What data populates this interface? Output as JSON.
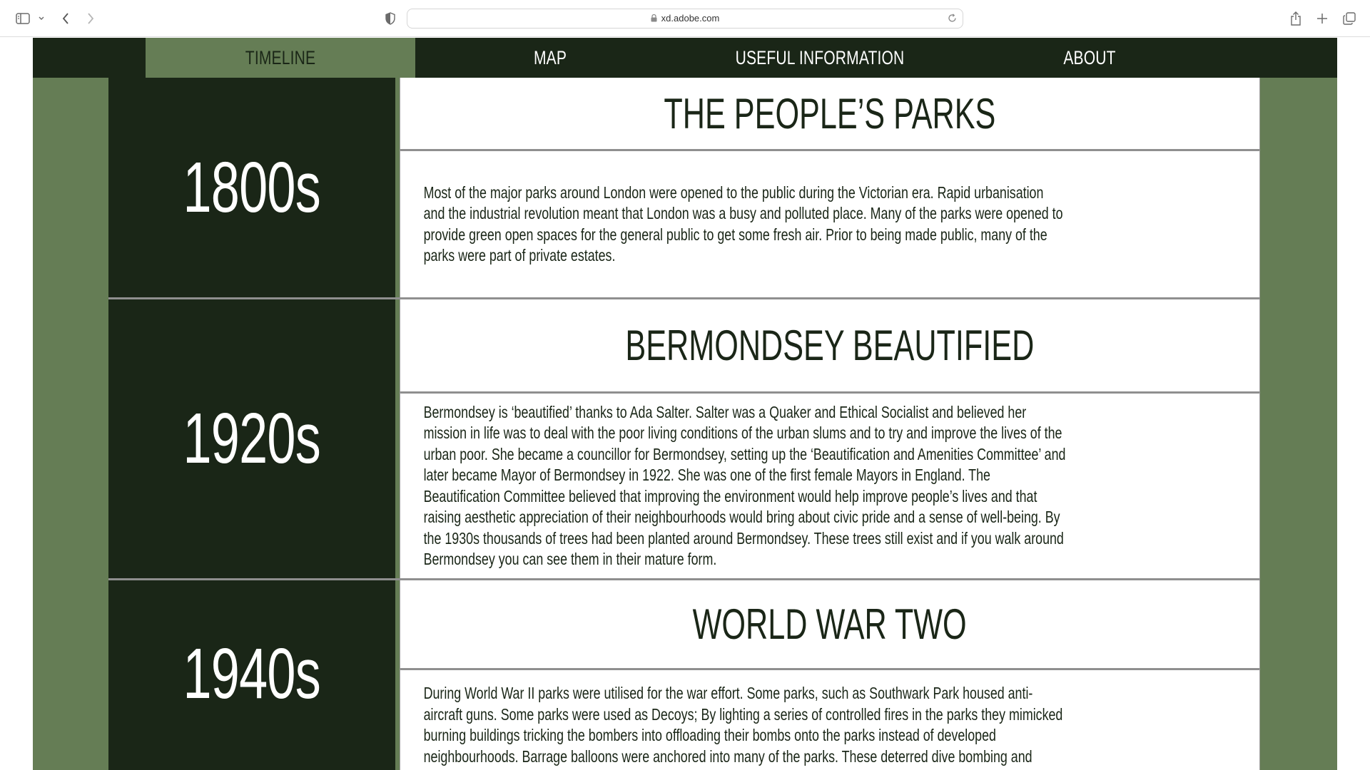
{
  "browser": {
    "url": "xd.adobe.com"
  },
  "nav": {
    "items": [
      {
        "label": "TIMELINE",
        "active": true
      },
      {
        "label": "MAP",
        "active": false
      },
      {
        "label": "USEFUL INFORMATION",
        "active": false
      },
      {
        "label": "ABOUT",
        "active": false
      }
    ]
  },
  "timeline": [
    {
      "decade": "1800s",
      "title": "THE PEOPLE’S PARKS",
      "body": "Most of the major parks around London were opened to the public during the Victorian era. Rapid urbanisation and the industrial revolution meant that London was a busy and polluted place. Many of the parks were opened to provide green open spaces for the general public to get some fresh air. Prior to being made public, many of the parks were part of private estates."
    },
    {
      "decade": "1920s",
      "title": "BERMONDSEY BEAUTIFIED",
      "body": "Bermondsey is ‘beautified’ thanks to Ada Salter. Salter was a Quaker and Ethical Socialist and believed her mission in life was to deal with the poor living conditions of the urban slums and to try and improve the lives of the urban poor. She became a councillor for Bermondsey, setting up the ‘Beautification and Amenities Committee’ and later became Mayor of Bermondsey in 1922. She was one of the first female Mayors in England. The Beautification Committee believed that improving the environment would help improve people’s lives and that raising aesthetic appreciation of their neighbourhoods would bring about civic pride and a sense of well-being. By the 1930s thousands of trees had been planted around Bermondsey. These trees still exist and if you walk around Bermondsey you can see them in their mature form."
    },
    {
      "decade": "1940s",
      "title": "WORLD WAR TWO",
      "body": "During World War II parks were utilised for the war effort. Some parks, such as Southwark Park housed anti-aircraft guns. Some parks were used as Decoys; By lighting a series of controlled fires in the parks they mimicked burning buildings tricking the bombers into offloading their bombs onto the parks instead of developed neighbourhoods. Barrage balloons were anchored into many of the parks. These deterred dive bombing and prevented enemy planes from flying too low."
    }
  ],
  "colors": {
    "dark_green": "#1a2617",
    "sage_green": "#657d55",
    "card_border": "#8f8f8f"
  }
}
